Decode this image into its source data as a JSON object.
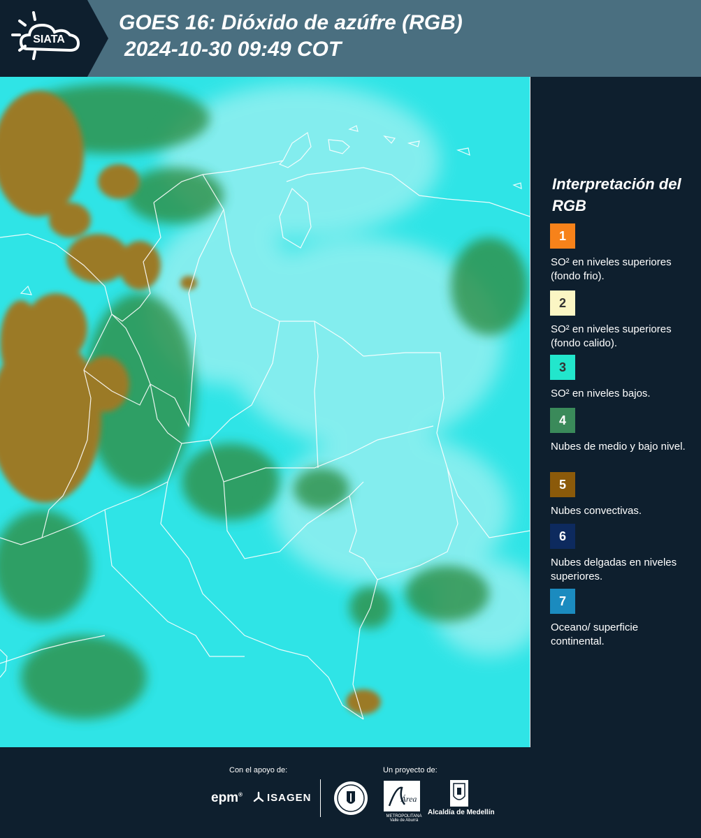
{
  "header": {
    "title_line_1": "GOES 16: Dióxido de azúfre (RGB)",
    "title_line_2": "2024-10-30 09:49 COT",
    "logo_text": "SIATA",
    "background_color": "#4a6f80"
  },
  "map": {
    "background_color": "#2de6e6",
    "cloud_colors": {
      "convective": "#9a7a2a",
      "mid_low": "#2c8a3c",
      "surface": "#2de6e6",
      "thin": "#c8f4f4"
    },
    "border_color": "#ffffff"
  },
  "legend": {
    "title": "Interpretación del RGB",
    "items": [
      {
        "number": "1",
        "color": "#f7821a",
        "text_color": "#ffffff",
        "description": "SO² en niveles superiores (fondo frio)."
      },
      {
        "number": "2",
        "color": "#fbf6c4",
        "text_color": "#333333",
        "description": "SO² en niveles superiores (fondo calido)."
      },
      {
        "number": "3",
        "color": "#22e6cc",
        "text_color": "#333333",
        "description": "SO² en niveles bajos."
      },
      {
        "number": "4",
        "color": "#3a8a5a",
        "text_color": "#ffffff",
        "description": "Nubes de medio y bajo nivel."
      },
      {
        "number": "5",
        "color": "#8b5a0a",
        "text_color": "#ffffff",
        "description": "Nubes convectivas."
      },
      {
        "number": "6",
        "color": "#0d2a5e",
        "text_color": "#ffffff",
        "description": "Nubes delgadas en niveles superiores."
      },
      {
        "number": "7",
        "color": "#1b8bbf",
        "text_color": "#ffffff",
        "description": "Oceano/ superficie continental."
      }
    ]
  },
  "footer": {
    "support_caption": "Con el apoyo de:",
    "project_caption": "Un proyecto de:",
    "epm": "epm",
    "epm_mark": "®",
    "isagen": "ISAGEN",
    "area_name": "METROPOLITANA Valle de Aburrá",
    "area_script": "Área",
    "alcaldia": "Alcaldía de Medellín"
  }
}
